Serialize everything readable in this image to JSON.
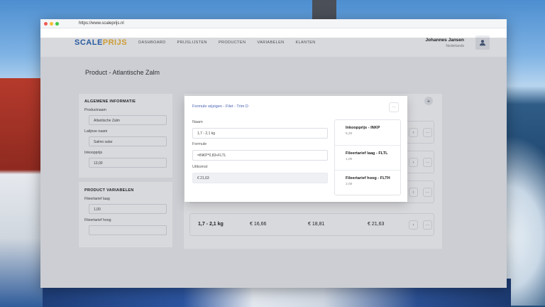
{
  "browser": {
    "url": "https://www.scaleprijs.nl"
  },
  "brand": {
    "logo_part1": "SCALE",
    "logo_part2": "PRIJS",
    "colors": {
      "primary": "#2a66b8",
      "accent": "#f2b531",
      "link": "#4a63b4"
    }
  },
  "nav": {
    "items": [
      "DASHBOARD",
      "PRIJSLIJSTEN",
      "PRODUCTEN",
      "VARIABELEN",
      "KLANTEN"
    ]
  },
  "user": {
    "name": "Johannes Jansen",
    "location": "Nederlands",
    "avatar_icon": "user-icon"
  },
  "page": {
    "title": "Product - Atlantische Zalm"
  },
  "general": {
    "heading": "ALGEMENE INFORMATIE",
    "fields": [
      {
        "label": "Productnaam",
        "value": "Atlantische Zalm"
      },
      {
        "label": "Latijnse naam",
        "value": "Salmo salar"
      },
      {
        "label": "Inkoopprijs",
        "value": "13,00"
      }
    ]
  },
  "variables": {
    "heading": "PRODUCT VARIABELEN",
    "fields": [
      {
        "label": "Fileertarief laag",
        "value": "1,00"
      },
      {
        "label": "Fileertarief hoog",
        "value": ""
      }
    ]
  },
  "price_row": {
    "range": "1,7 - 2,1 kg",
    "values": [
      "€ 16,66",
      "€ 18,81",
      "€ 21,63"
    ]
  },
  "modal": {
    "title": "Formule wijzigen - Filet - Trim D",
    "more_label": "···",
    "fields": [
      {
        "label": "Naam",
        "value": "1,7 - 2,1 kg"
      },
      {
        "label": "Formule",
        "value": "=INKP*0,83+FLTL"
      },
      {
        "label": "Uitkomst",
        "value": "€ 21,63"
      }
    ],
    "variables": [
      {
        "title": "Inkoopprijs - INKP",
        "value": "5,20"
      },
      {
        "title": "Fileertarief laag - FLTL",
        "value": "1,00"
      },
      {
        "title": "Fileertarief hoog - FLTH",
        "value": "2,00"
      }
    ]
  }
}
